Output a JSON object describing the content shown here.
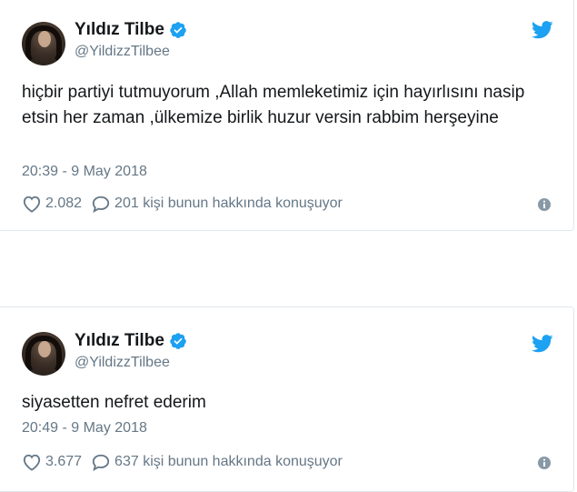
{
  "colors": {
    "twitter_blue": "#1da1f2",
    "text": "#14171a",
    "secondary": "#657786",
    "border": "#e1e8ed"
  },
  "icons": {
    "verified": "verified-badge-icon",
    "brand": "twitter-bird-icon",
    "like": "heart-icon",
    "reply": "speech-bubble-icon",
    "info": "info-icon"
  },
  "tweets": [
    {
      "name": "Yıldız Tilbe",
      "handle": "@YildizzTilbee",
      "text": "hiçbir partiyi tutmuyorum ,Allah memleketimiz için hayırlısını nasip etsin her zaman ,ülkemize birlik huzur versin rabbim herşeyine",
      "time": "20:39 - 9 May 2018",
      "likes": "2.082",
      "replies": "201 kişi bunun hakkında konuşuyor"
    },
    {
      "name": "Yıldız Tilbe",
      "handle": "@YildizzTilbee",
      "text": "siyasetten nefret ederim",
      "time": "20:49 - 9 May 2018",
      "likes": "3.677",
      "replies": "637 kişi bunun hakkında konuşuyor"
    }
  ]
}
